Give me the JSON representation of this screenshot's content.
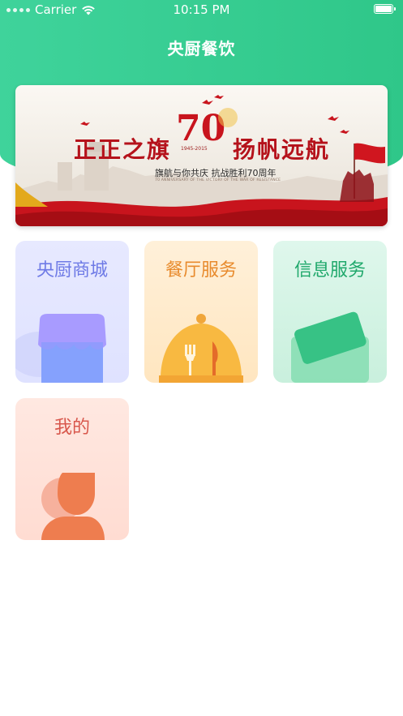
{
  "status_bar": {
    "carrier": "Carrier",
    "time": "10:15 PM"
  },
  "header": {
    "title": "央厨餐饮"
  },
  "banner": {
    "left_text": "正正之旗",
    "badge_number": "70",
    "years": "1945-2015",
    "right_text": "扬帆远航",
    "subtitle": "旗航与你共庆 抗战胜利70周年",
    "subtitle_en": "70 ANNIVERSARY OF THE VICTORY OF THE WAR OF RESISTANCE"
  },
  "tiles": [
    {
      "label": "央厨商城",
      "icon": "store-icon",
      "color": "#6e7ae6"
    },
    {
      "label": "餐厅服务",
      "icon": "dining-cloche-icon",
      "color": "#e88a2c"
    },
    {
      "label": "信息服务",
      "icon": "card-icon",
      "color": "#1fa86b"
    },
    {
      "label": "我的",
      "icon": "user-icon",
      "color": "#d8574c"
    }
  ]
}
